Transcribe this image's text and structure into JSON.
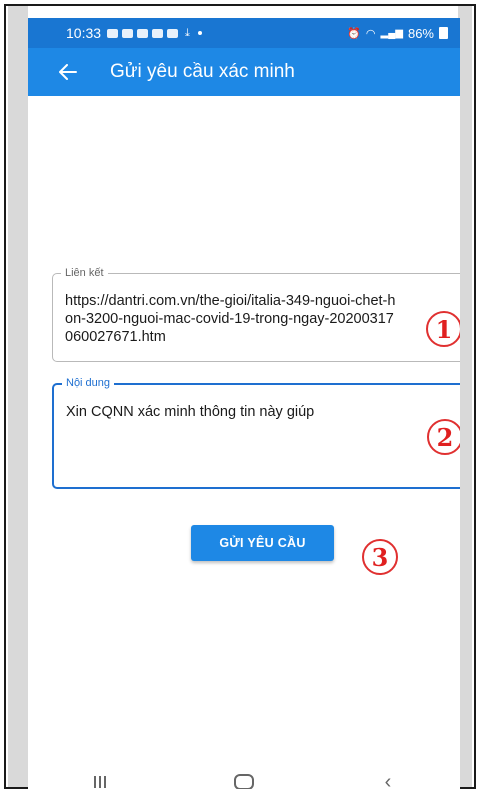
{
  "status_bar": {
    "time": "10:33",
    "battery": "86%"
  },
  "app_bar": {
    "back_icon": "arrow-left-icon",
    "title": "Gửi yêu cầu xác minh"
  },
  "form": {
    "link": {
      "label": "Liên kết",
      "value": "https://dantri.com.vn/the-gioi/italia-349-nguoi-chet-hon-3200-nguoi-mac-covid-19-trong-ngay-20200317060027671.htm"
    },
    "content": {
      "label": "Nội dung",
      "value": "Xin CQNN xác minh thông tin này giúp"
    },
    "submit_label": "GỬI YÊU CẦU"
  },
  "annotations": [
    "1",
    "2",
    "3"
  ],
  "colors": {
    "primary": "#1e88e5",
    "annotation": "#e02020"
  }
}
